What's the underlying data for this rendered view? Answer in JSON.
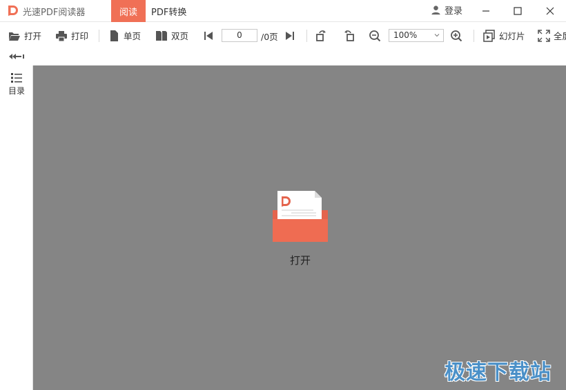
{
  "titlebar": {
    "app_title": "光速PDF阅读器",
    "tab_read": "阅读",
    "tab_convert": "PDF转换",
    "login": "登录",
    "accent": "#f07056"
  },
  "toolbar": {
    "open": "打开",
    "print": "打印",
    "single_page": "单页",
    "double_page": "双页",
    "page_value": "0",
    "page_total": "/0页",
    "zoom_value": "100%",
    "slideshow": "幻灯片",
    "fullscreen": "全屏"
  },
  "sidebar": {
    "toc": "目录"
  },
  "main": {
    "open_label": "打开",
    "watermark": "极速下载站",
    "background": "#858585"
  },
  "icons": [
    "logo-icon",
    "user-icon",
    "minimize-icon",
    "maximize-icon",
    "close-icon",
    "folder-open-icon",
    "printer-icon",
    "single-page-icon",
    "double-page-icon",
    "first-page-icon",
    "last-page-icon",
    "rotate-right-icon",
    "rotate-left-icon",
    "zoom-out-icon",
    "zoom-in-icon",
    "slideshow-icon",
    "fullscreen-icon",
    "collapse-icon",
    "toc-icon",
    "open-file-folder-icon"
  ]
}
